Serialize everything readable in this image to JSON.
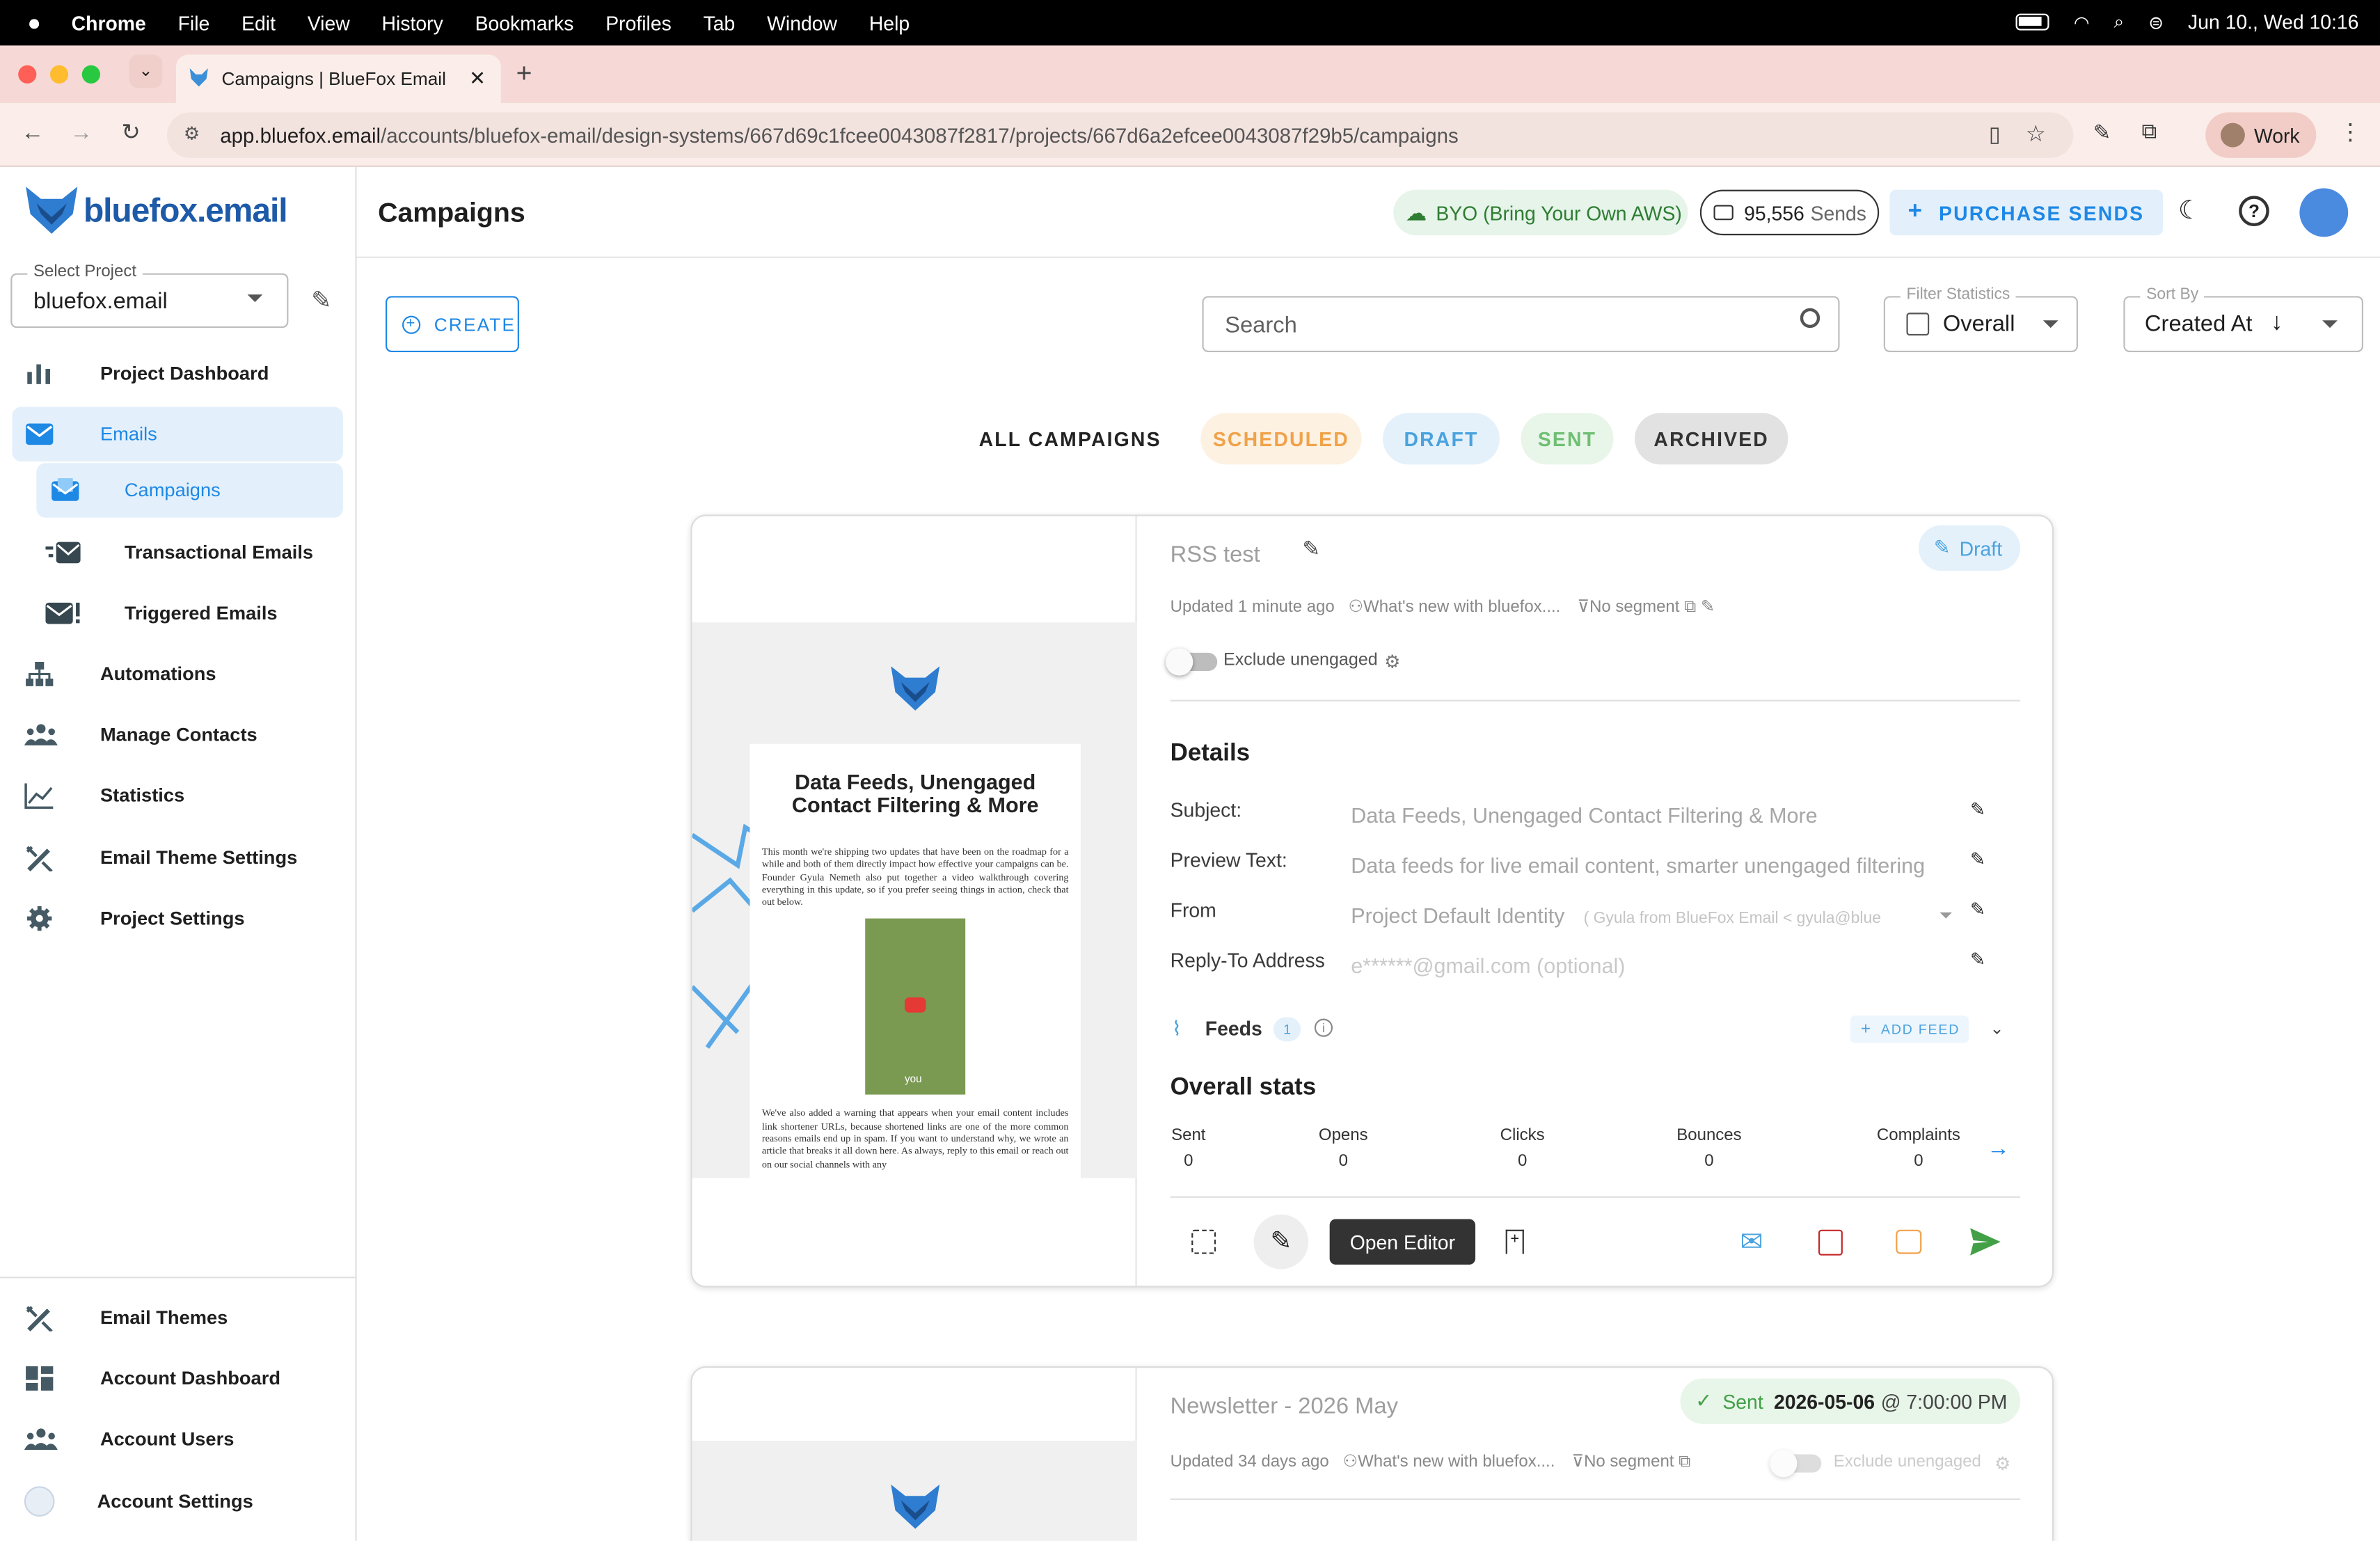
{
  "menubar": {
    "app": "Chrome",
    "items": [
      "File",
      "Edit",
      "View",
      "History",
      "Bookmarks",
      "Profiles",
      "Tab",
      "Window",
      "Help"
    ],
    "datetime": "Jun 10., Wed  10:16"
  },
  "browser": {
    "tab_title": "Campaigns | BlueFox Email",
    "url_domain": "app.bluefox.email",
    "url_path": "/accounts/bluefox-email/design-systems/667d69c1fcee0043087f2817/projects/667d6a2efcee0043087f29b5/campaigns",
    "profile": "Work"
  },
  "sidebar": {
    "logo": "bluefox.email",
    "select_project_label": "Select Project",
    "select_project_value": "bluefox.email",
    "items": [
      {
        "label": "Project Dashboard",
        "icon": "chart-bars-icon"
      },
      {
        "label": "Emails",
        "icon": "mail-icon"
      },
      {
        "label": "Campaigns",
        "icon": "campaign-mail-icon"
      },
      {
        "label": "Transactional Emails",
        "icon": "fast-mail-icon"
      },
      {
        "label": "Triggered Emails",
        "icon": "mail-alert-icon"
      },
      {
        "label": "Automations",
        "icon": "sitemap-icon"
      },
      {
        "label": "Manage Contacts",
        "icon": "people-icon"
      },
      {
        "label": "Statistics",
        "icon": "line-chart-icon"
      },
      {
        "label": "Email Theme Settings",
        "icon": "design-tools-icon"
      },
      {
        "label": "Project Settings",
        "icon": "gear-icon"
      }
    ],
    "bottom_items": [
      {
        "label": "Email Themes",
        "icon": "design-tools-icon"
      },
      {
        "label": "Account Dashboard",
        "icon": "dashboard-icon"
      },
      {
        "label": "Account Users",
        "icon": "people-icon"
      },
      {
        "label": "Account Settings",
        "icon": "avatar-icon"
      }
    ]
  },
  "header": {
    "title": "Campaigns",
    "byo_label": "BYO (Bring Your Own AWS)",
    "sends_count": "95,556",
    "sends_label": "Sends",
    "purchase_label": "PURCHASE SENDS"
  },
  "toolbar": {
    "create_label": "CREATE",
    "search_placeholder": "Search",
    "filter_label": "Filter Statistics",
    "filter_value": "Overall",
    "sort_label": "Sort By",
    "sort_value": "Created At"
  },
  "filter_tabs": [
    {
      "label": "ALL CAMPAIGNS"
    },
    {
      "label": "SCHEDULED"
    },
    {
      "label": "DRAFT"
    },
    {
      "label": "SENT"
    },
    {
      "label": "ARCHIVED"
    }
  ],
  "campaign1": {
    "name": "RSS test",
    "status": "Draft",
    "updated": "Updated 1 minute ago",
    "audience": "What's new with bluefox....",
    "segment": "No segment",
    "exclude_label": "Exclude unengaged",
    "details_title": "Details",
    "subject_label": "Subject:",
    "subject_value": "Data Feeds, Unengaged Contact Filtering & More",
    "preview_label": "Preview Text:",
    "preview_value": "Data feeds for live email content, smarter unengaged filtering",
    "from_label": "From",
    "from_value": "Project Default Identity",
    "from_sub": "( Gyula from BlueFox Email < gyula@blue",
    "reply_label": "Reply-To Address",
    "reply_value": "e******@gmail.com (optional)",
    "feeds_label": "Feeds",
    "feeds_count": "1",
    "add_feed_label": "ADD FEED",
    "stats_title": "Overall stats",
    "stats": [
      {
        "label": "Sent",
        "value": "0"
      },
      {
        "label": "Opens",
        "value": "0"
      },
      {
        "label": "Clicks",
        "value": "0"
      },
      {
        "label": "Bounces",
        "value": "0"
      },
      {
        "label": "Complaints",
        "value": "0"
      }
    ],
    "open_editor_label": "Open Editor",
    "email_preview": {
      "headline": "Data Feeds, Unengaged Contact Filtering & More",
      "para1": "This month we're shipping two updates that have been on the roadmap for a while and both of them directly impact how effective your campaigns can be. Founder Gyula Nemeth also put together a video walkthrough covering everything in this update, so if you prefer seeing things in action, check that out below.",
      "video_caption": "you",
      "para2": "We've also added a warning that appears when your email content includes link shortener URLs, because shortened links are one of the more common reasons emails end up in spam. If you want to understand why, we wrote an article that breaks it all down here. As always, reply to this email or reach out on our social channels with any"
    }
  },
  "campaign2": {
    "name": "Newsletter - 2026 May",
    "status": "Sent",
    "sent_date": "2026-05-06",
    "sent_time": "@ 7:00:00 PM",
    "updated": "Updated 34 days ago",
    "audience": "What's new with bluefox....",
    "segment": "No segment",
    "exclude_label": "Exclude unengaged"
  }
}
